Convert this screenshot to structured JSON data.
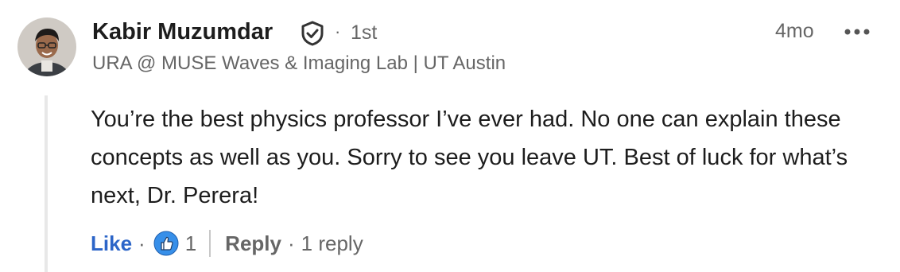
{
  "author": {
    "name": "Kabir Muzumdar",
    "degree": "1st",
    "headline": "URA @ MUSE Waves & Imaging Lab | UT Austin",
    "verified_icon": "shield-check-icon"
  },
  "meta": {
    "separator": "·",
    "time": "4mo",
    "more_icon": "more-horizontal-icon"
  },
  "comment": {
    "text": "You’re the best physics professor I’ve ever had. No one can explain these concepts as well as you. Sorry to see you leave UT. Best of luck for what’s next, Dr. Perera!"
  },
  "actions": {
    "like_label": "Like",
    "separator": "·",
    "reaction_icon": "thumbs-up-icon",
    "reaction_count": "1",
    "reply_label": "Reply",
    "reply_count": "1 reply"
  },
  "colors": {
    "like": "#2c65c8",
    "reaction_bg": "#378fe9",
    "muted": "#666666",
    "text": "#1d1d1d"
  }
}
